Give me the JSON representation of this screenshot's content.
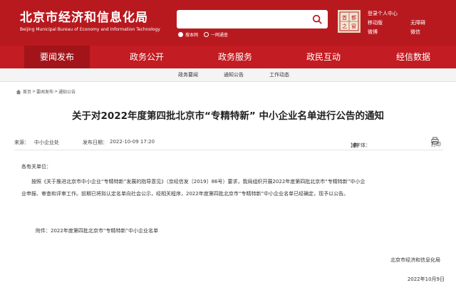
{
  "header": {
    "site_name": "北京市经济和信息化局",
    "site_name_en": "Beijing Municipal Bureau of Economy and Information Technology",
    "search": {
      "placeholder": "",
      "scope_site": "搜本网",
      "scope_net": "一网通查"
    },
    "seal_text": [
      "首",
      "都",
      "之",
      "窗"
    ],
    "links": {
      "login": "登录个人中心",
      "mobile": "移动版",
      "accessible": "无障碍",
      "weibo": "微博",
      "wechat": "微信"
    }
  },
  "nav": {
    "items": [
      "要闻发布",
      "政务公开",
      "政务服务",
      "政民互动",
      "经信数据"
    ],
    "active_index": 0
  },
  "subnav": {
    "items": [
      "政务要闻",
      "通知公告",
      "工作动态"
    ]
  },
  "breadcrumb": {
    "items": [
      "首页",
      "要闻发布",
      "通知公告"
    ]
  },
  "article": {
    "title": "关于对2022年度第四批北京市“专精特新” 中小企业名单进行公告的通知",
    "source_label": "来源：",
    "source": "中小企业处",
    "publish_label": "发布日期：",
    "publish_date": "2022-10-09 17:20",
    "font_label": "【字体：",
    "font_options": [
      "大",
      "中",
      "小"
    ],
    "font_close": "】",
    "print_label": "打印",
    "greeting": "各有关单位：",
    "paragraph_line1": "按照《关于推进北京市中小企业“专精特新”发展的指导意见》（京经信发〔2019〕86号）要求，我局组织开展2022年度第四批北京市“专精特新”中小企",
    "paragraph_line2": "业申报、审查和评审工作。前期已将拟认定名单向社会公示，经相关程序，2022年度第四批北京市“专精特新”中小企业名单已经确定，现予以公告。",
    "attachment": "附件：2022年度第四批北京市“专精特新”中小企业名单",
    "signature": "北京市经济和信息化局",
    "date": "2022年10月9日"
  },
  "colors": {
    "brand_red": "#b8191f",
    "nav_red": "#c31c22",
    "nav_active": "#a3141a"
  },
  "icons": [
    "search-icon",
    "home-icon",
    "print-icon",
    "seal-logo"
  ]
}
